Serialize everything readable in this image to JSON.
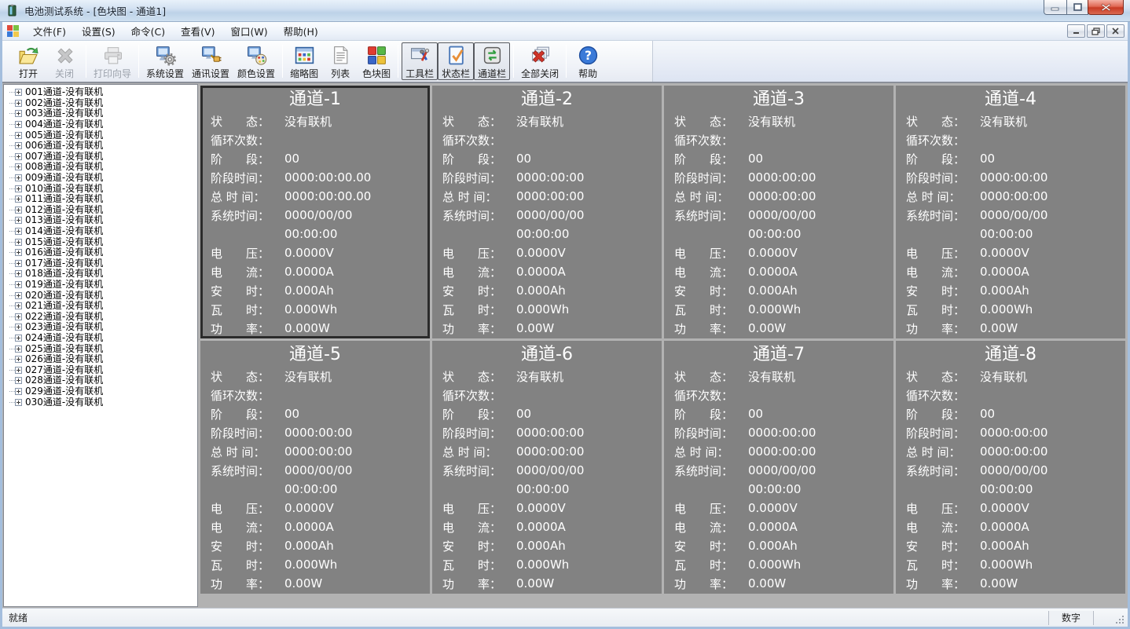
{
  "window": {
    "title": "电池测试系统 - [色块图 - 通道1]",
    "app_icon": "battery-app-icon",
    "controls": [
      {
        "id": "minimize",
        "name": "minimize-button"
      },
      {
        "id": "maximize",
        "name": "maximize-button"
      },
      {
        "id": "close",
        "name": "close-button"
      }
    ]
  },
  "menu": {
    "logo_icon": "app-grid-icon",
    "items": [
      {
        "label": "文件(F)"
      },
      {
        "label": "设置(S)"
      },
      {
        "label": "命令(C)"
      },
      {
        "label": "查看(V)"
      },
      {
        "label": "窗口(W)"
      },
      {
        "label": "帮助(H)"
      }
    ],
    "mdi_controls": [
      {
        "id": "mdi-minimize",
        "name": "mdi-minimize-button"
      },
      {
        "id": "mdi-restore",
        "name": "mdi-restore-button"
      },
      {
        "id": "mdi-close",
        "name": "mdi-close-button"
      }
    ]
  },
  "toolbar": {
    "buttons": [
      {
        "type": "button",
        "id": "open",
        "label": "打开",
        "icon": "folder-open-icon",
        "state": "normal"
      },
      {
        "type": "button",
        "id": "close-doc",
        "label": "关闭",
        "icon": "close-gray-icon",
        "state": "disabled"
      },
      {
        "type": "separator"
      },
      {
        "type": "button",
        "id": "print-wizard",
        "label": "打印向导",
        "icon": "printer-icon",
        "state": "disabled"
      },
      {
        "type": "separator"
      },
      {
        "type": "button",
        "id": "system-settings",
        "label": "系统设置",
        "icon": "computer-gear-icon",
        "state": "normal"
      },
      {
        "type": "button",
        "id": "comm-settings",
        "label": "通讯设置",
        "icon": "computer-plug-icon",
        "state": "normal"
      },
      {
        "type": "button",
        "id": "color-settings",
        "label": "颜色设置",
        "icon": "computer-palette-icon",
        "state": "normal"
      },
      {
        "type": "separator"
      },
      {
        "type": "button",
        "id": "thumbnail-view",
        "label": "缩略图",
        "icon": "grid-thumbnail-icon",
        "state": "normal"
      },
      {
        "type": "button",
        "id": "list-view",
        "label": "列表",
        "icon": "list-doc-icon",
        "state": "normal"
      },
      {
        "type": "button",
        "id": "colorblock-view",
        "label": "色块图",
        "icon": "color-blocks-icon",
        "state": "normal"
      },
      {
        "type": "separator"
      },
      {
        "type": "button",
        "id": "toolbar-toggle",
        "label": "工具栏",
        "icon": "toolbar-window-icon",
        "state": "pressed"
      },
      {
        "type": "button",
        "id": "statusbar-toggle",
        "label": "状态栏",
        "icon": "statusbar-check-icon",
        "state": "pressed"
      },
      {
        "type": "button",
        "id": "channelbar-toggle",
        "label": "通道栏",
        "icon": "channel-swap-icon",
        "state": "pressed"
      },
      {
        "type": "separator"
      },
      {
        "type": "button",
        "id": "close-all",
        "label": "全部关闭",
        "icon": "close-all-icon",
        "state": "normal"
      },
      {
        "type": "separator"
      },
      {
        "type": "button",
        "id": "help",
        "label": "帮助",
        "icon": "help-icon",
        "state": "normal"
      }
    ]
  },
  "tree": {
    "items": [
      "001通道-没有联机",
      "002通道-没有联机",
      "003通道-没有联机",
      "004通道-没有联机",
      "005通道-没有联机",
      "006通道-没有联机",
      "007通道-没有联机",
      "008通道-没有联机",
      "009通道-没有联机",
      "010通道-没有联机",
      "011通道-没有联机",
      "012通道-没有联机",
      "013通道-没有联机",
      "014通道-没有联机",
      "015通道-没有联机",
      "016通道-没有联机",
      "017通道-没有联机",
      "018通道-没有联机",
      "019通道-没有联机",
      "020通道-没有联机",
      "021通道-没有联机",
      "022通道-没有联机",
      "023通道-没有联机",
      "024通道-没有联机",
      "025通道-没有联机",
      "026通道-没有联机",
      "027通道-没有联机",
      "028通道-没有联机",
      "029通道-没有联机",
      "030通道-没有联机"
    ]
  },
  "panels": {
    "row_labels": [
      "状　　态：",
      "循环次数：",
      "阶　　段：",
      "阶段时间：",
      "总 时 间：",
      "系统时间：",
      "",
      "电　　压：",
      "电　　流：",
      "安　　时：",
      "瓦　　时：",
      "功　　率："
    ],
    "channels": [
      {
        "title": "通道-1",
        "selected": true,
        "values": [
          "没有联机",
          "",
          "00",
          "0000:00:00.00",
          "0000:00:00.00",
          "0000/00/00",
          "00:00:00",
          "0.0000V",
          "0.0000A",
          "0.000Ah",
          "0.000Wh",
          "0.000W"
        ]
      },
      {
        "title": "通道-2",
        "selected": false,
        "values": [
          "没有联机",
          "",
          "00",
          "0000:00:00",
          "0000:00:00",
          "0000/00/00",
          "00:00:00",
          "0.0000V",
          "0.0000A",
          "0.000Ah",
          "0.000Wh",
          "0.00W"
        ]
      },
      {
        "title": "通道-3",
        "selected": false,
        "values": [
          "没有联机",
          "",
          "00",
          "0000:00:00",
          "0000:00:00",
          "0000/00/00",
          "00:00:00",
          "0.0000V",
          "0.0000A",
          "0.000Ah",
          "0.000Wh",
          "0.00W"
        ]
      },
      {
        "title": "通道-4",
        "selected": false,
        "values": [
          "没有联机",
          "",
          "00",
          "0000:00:00",
          "0000:00:00",
          "0000/00/00",
          "00:00:00",
          "0.0000V",
          "0.0000A",
          "0.000Ah",
          "0.000Wh",
          "0.00W"
        ]
      },
      {
        "title": "通道-5",
        "selected": false,
        "values": [
          "没有联机",
          "",
          "00",
          "0000:00:00",
          "0000:00:00",
          "0000/00/00",
          "00:00:00",
          "0.0000V",
          "0.0000A",
          "0.000Ah",
          "0.000Wh",
          "0.00W"
        ]
      },
      {
        "title": "通道-6",
        "selected": false,
        "values": [
          "没有联机",
          "",
          "00",
          "0000:00:00",
          "0000:00:00",
          "0000/00/00",
          "00:00:00",
          "0.0000V",
          "0.0000A",
          "0.000Ah",
          "0.000Wh",
          "0.00W"
        ]
      },
      {
        "title": "通道-7",
        "selected": false,
        "values": [
          "没有联机",
          "",
          "00",
          "0000:00:00",
          "0000:00:00",
          "0000/00/00",
          "00:00:00",
          "0.0000V",
          "0.0000A",
          "0.000Ah",
          "0.000Wh",
          "0.00W"
        ]
      },
      {
        "title": "通道-8",
        "selected": false,
        "values": [
          "没有联机",
          "",
          "00",
          "0000:00:00",
          "0000:00:00",
          "0000/00/00",
          "00:00:00",
          "0.0000V",
          "0.0000A",
          "0.000Ah",
          "0.000Wh",
          "0.00W"
        ]
      }
    ]
  },
  "statusbar": {
    "ready": "就绪",
    "num": "数字"
  },
  "colors": {
    "panel_bg": "#828282",
    "panel_selected_border": "#2b2b2b",
    "panel_text": "#ffffff",
    "titlebar": "#cfe0f0",
    "mdi_bg": "#b2b2b2"
  }
}
